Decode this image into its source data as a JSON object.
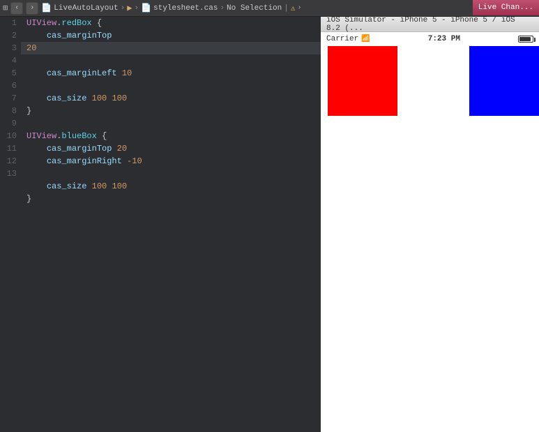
{
  "topbar": {
    "nav_back": "‹",
    "nav_forward": "›",
    "breadcrumb": [
      {
        "label": "LiveAutoLayout",
        "icon": "📄",
        "type": "project"
      },
      {
        "label": "›",
        "type": "sep"
      },
      {
        "label": "",
        "icon": "📁",
        "type": "folder"
      },
      {
        "label": "›",
        "type": "sep"
      },
      {
        "label": "stylesheet.cas",
        "icon": "📄",
        "type": "file"
      },
      {
        "label": "›",
        "type": "sep"
      },
      {
        "label": "No Selection",
        "type": "selection"
      }
    ],
    "warning_icon": "⚠",
    "chevron": "›"
  },
  "editor": {
    "lines": [
      "1",
      "2",
      "3",
      "4",
      "5",
      "6",
      "7",
      "8",
      "9",
      "10",
      "11",
      "12",
      "13"
    ],
    "code": [
      {
        "line": 1,
        "text": "UIView.redBox {"
      },
      {
        "line": 2,
        "text": "    cas_marginTop 20"
      },
      {
        "line": 3,
        "text": "    cas_marginLeft 10"
      },
      {
        "line": 4,
        "text": ""
      },
      {
        "line": 5,
        "text": "    cas_size 100 100"
      },
      {
        "line": 6,
        "text": "}"
      },
      {
        "line": 7,
        "text": ""
      },
      {
        "line": 8,
        "text": "UIView.blueBox {"
      },
      {
        "line": 9,
        "text": "    cas_marginTop 20"
      },
      {
        "line": 10,
        "text": "    cas_marginRight -10"
      },
      {
        "line": 11,
        "text": ""
      },
      {
        "line": 12,
        "text": "    cas_size 100 100"
      },
      {
        "line": 13,
        "text": "}"
      }
    ]
  },
  "simulator": {
    "title": "iOS Simulator - iPhone 5 - iPhone 5 / iOS 8.2 (...",
    "status_bar": {
      "carrier": "Carrier",
      "time": "7:23 PM"
    },
    "live_change": "Live Chan..."
  }
}
